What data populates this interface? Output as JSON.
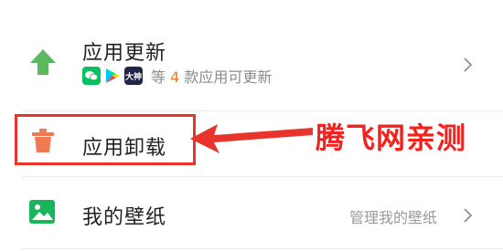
{
  "colors": {
    "update_icon": "#5cb85c",
    "uninstall_icon": "#f07a52",
    "wallpaper_icon": "#19b55a",
    "accent_count": "#f07a2c",
    "annotation_red": "#e8342a"
  },
  "rows": {
    "update": {
      "title": "应用更新",
      "subtitle_prefix": "等",
      "count": "4",
      "subtitle_suffix": "款应用可更新",
      "icon": "arrow-up-icon",
      "mini_apps": [
        "wechat",
        "google-play",
        "dashen"
      ],
      "dashen_label": "大神"
    },
    "uninstall": {
      "title": "应用卸载",
      "icon": "trash-icon"
    },
    "wallpaper": {
      "title": "我的壁纸",
      "hint": "管理我的壁纸",
      "icon": "image-icon"
    }
  },
  "annotation": {
    "watermark": "腾飞网亲测"
  }
}
